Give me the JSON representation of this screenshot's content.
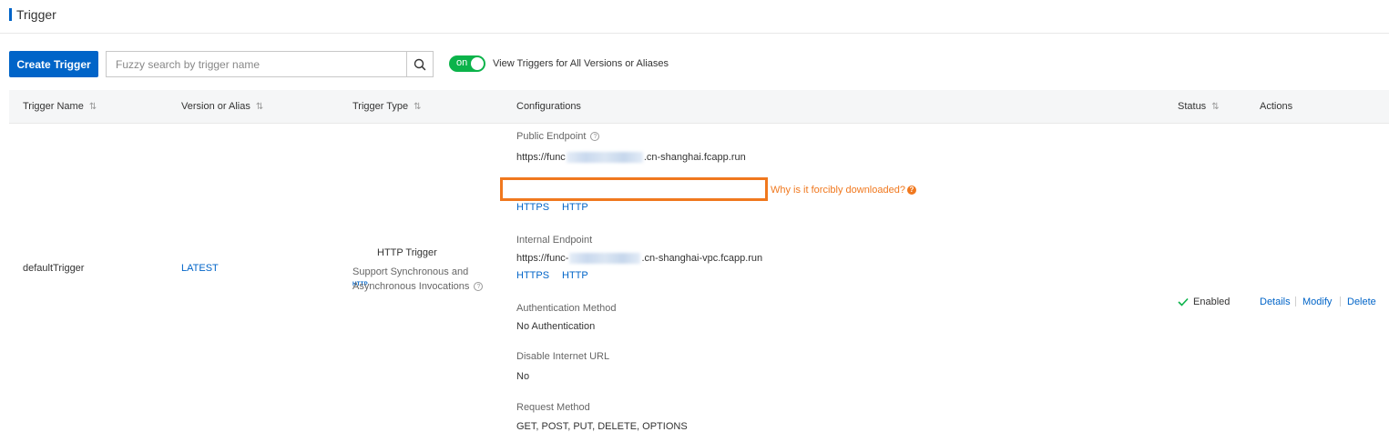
{
  "header": {
    "title": "Trigger"
  },
  "toolbar": {
    "create_label": "Create Trigger",
    "search_placeholder": "Fuzzy search by trigger name",
    "search_value": "",
    "toggle_text": "on",
    "toggle_label": "View Triggers for All Versions or Aliases"
  },
  "table": {
    "columns": [
      "Trigger Name",
      "Version or Alias",
      "Trigger Type",
      "Configurations",
      "Status",
      "Actions"
    ],
    "row": {
      "name": "defaultTrigger",
      "version": "LATEST",
      "type_badge": "HTTP",
      "type_title": "HTTP Trigger",
      "type_desc_1": "Support Synchronous and",
      "type_desc_2": "Asynchronous Invocations",
      "config": {
        "public_label": "Public Endpoint",
        "public_url_prefix": "https://func",
        "public_url_suffix": ".cn-shanghai.fcapp.run",
        "public_https": "HTTPS",
        "public_http": "HTTP",
        "warning": "Why is it forcibly downloaded?",
        "internal_label": "Internal Endpoint",
        "internal_url_prefix": "https://func-",
        "internal_url_suffix": ".cn-shanghai-vpc.fcapp.run",
        "internal_https": "HTTPS",
        "internal_http": "HTTP",
        "auth_label": "Authentication Method",
        "auth_value": "No Authentication",
        "disable_label": "Disable Internet URL",
        "disable_value": "No",
        "method_label": "Request Method",
        "method_value": "GET, POST, PUT, DELETE, OPTIONS"
      },
      "status": "Enabled",
      "actions": {
        "details": "Details",
        "modify": "Modify",
        "delete": "Delete"
      }
    }
  },
  "colors": {
    "primary": "#0064c8",
    "toggle_on": "#0bb34a",
    "highlight": "#f0781e",
    "status_ok": "#0bb34a"
  },
  "icons": [
    "search-icon",
    "sort-icon",
    "help-icon",
    "check-icon",
    "warning-help-icon"
  ]
}
